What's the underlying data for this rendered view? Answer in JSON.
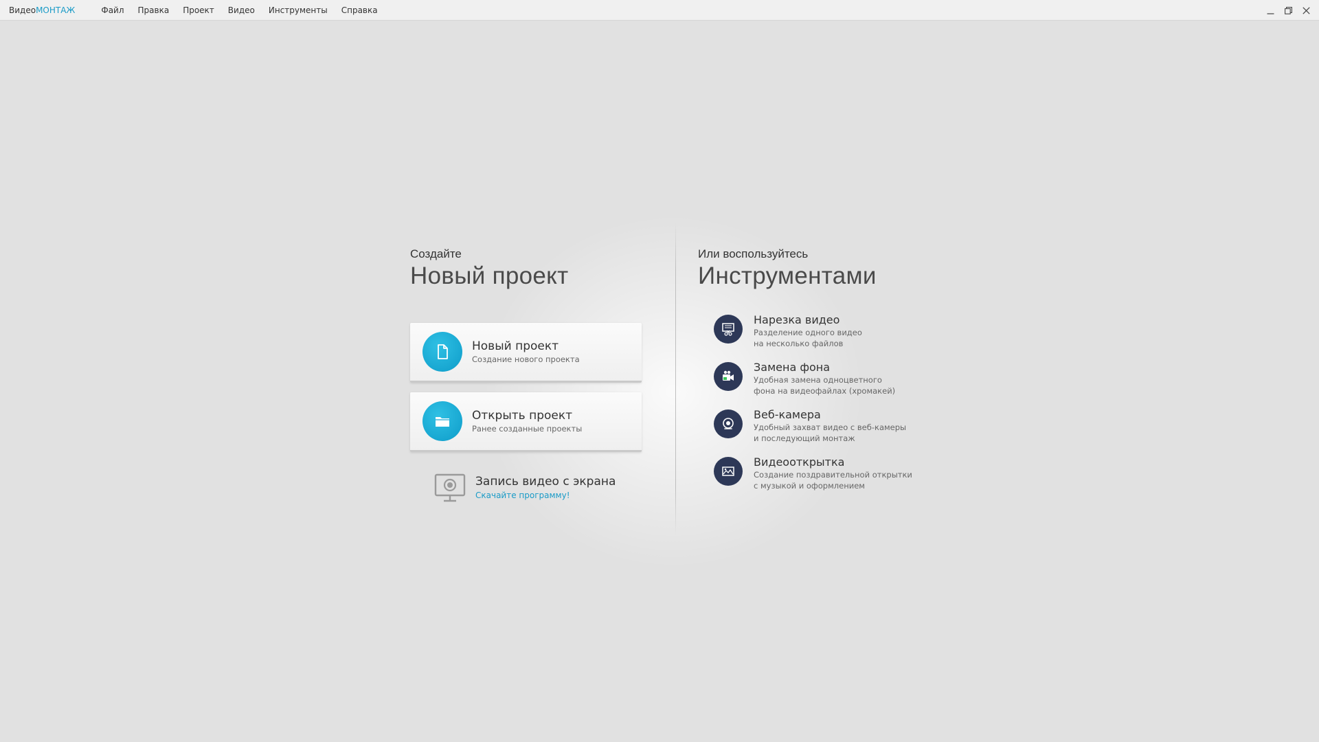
{
  "window": {
    "title_prefix": "Видео",
    "title_accent": "МОНТАЖ",
    "accent_color": "#1a9bc7",
    "controls": [
      "minimize-icon",
      "restore-icon",
      "close-icon"
    ]
  },
  "menu": {
    "items": [
      {
        "label": "Файл"
      },
      {
        "label": "Правка"
      },
      {
        "label": "Проект"
      },
      {
        "label": "Видео"
      },
      {
        "label": "Инструменты"
      },
      {
        "label": "Справка"
      }
    ]
  },
  "create": {
    "kicker": "Создайте",
    "title": "Новый проект",
    "cards": [
      {
        "title": "Новый проект",
        "subtitle": "Создание нового проекта",
        "icon": "document-icon"
      },
      {
        "title": "Открыть проект",
        "subtitle": "Ранее созданные проекты",
        "icon": "folder-icon"
      }
    ],
    "record": {
      "title": "Запись видео с экрана",
      "link": "Скачайте программу!",
      "icon": "screen-record-icon"
    },
    "card_color": "#1aa9d6"
  },
  "tools": {
    "kicker": "Или воспользуйтесь",
    "title": "Инструментами",
    "icon_bg": "#2d3857",
    "items": [
      {
        "title": "Нарезка видео",
        "desc_line1": "Разделение одного видео",
        "desc_line2": "на несколько файлов",
        "icon": "video-cut-icon"
      },
      {
        "title": "Замена фона",
        "desc_line1": "Удобная замена одноцветного",
        "desc_line2": "фона на видеофайлах (хромакей)",
        "icon": "chromakey-icon"
      },
      {
        "title": "Веб-камера",
        "desc_line1": "Удобный захват видео с веб-камеры",
        "desc_line2": "и последующий монтаж",
        "icon": "webcam-icon"
      },
      {
        "title": "Видеооткрытка",
        "desc_line1": "Создание поздравительной открытки",
        "desc_line2": "с музыкой и оформлением",
        "icon": "postcard-icon"
      }
    ]
  }
}
